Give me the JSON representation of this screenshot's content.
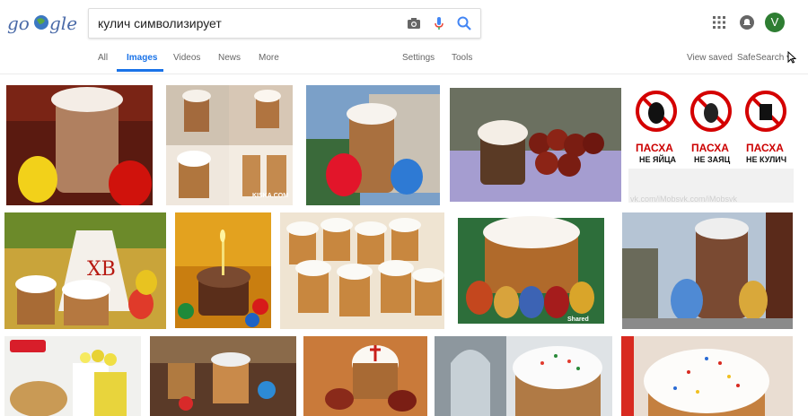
{
  "search": {
    "query": "кулич символизирует"
  },
  "tabs": [
    "All",
    "Images",
    "Videos",
    "News",
    "More"
  ],
  "tools": [
    "Settings",
    "Tools"
  ],
  "right": {
    "view_saved": "View saved",
    "safesearch": "SafeSearch ▾"
  },
  "avatar": {
    "letter": "V"
  },
  "poster": {
    "lines": [
      {
        "title": "ПАСХА",
        "sub": "НЕ ЯЙЦА"
      },
      {
        "title": "ПАСХА",
        "sub": "НЕ ЗАЯЦ"
      },
      {
        "title": "ПАСХА",
        "sub": "НЕ КУЛИЧ"
      }
    ]
  },
  "watermarks": {
    "vk": "vk.com/iMobsvk.com/iMobsvk",
    "kiss": "KISKA.COM",
    "shared": "Shared"
  },
  "icons": [
    "camera-icon",
    "mic-icon",
    "search-icon",
    "apps-icon",
    "bell-icon"
  ]
}
